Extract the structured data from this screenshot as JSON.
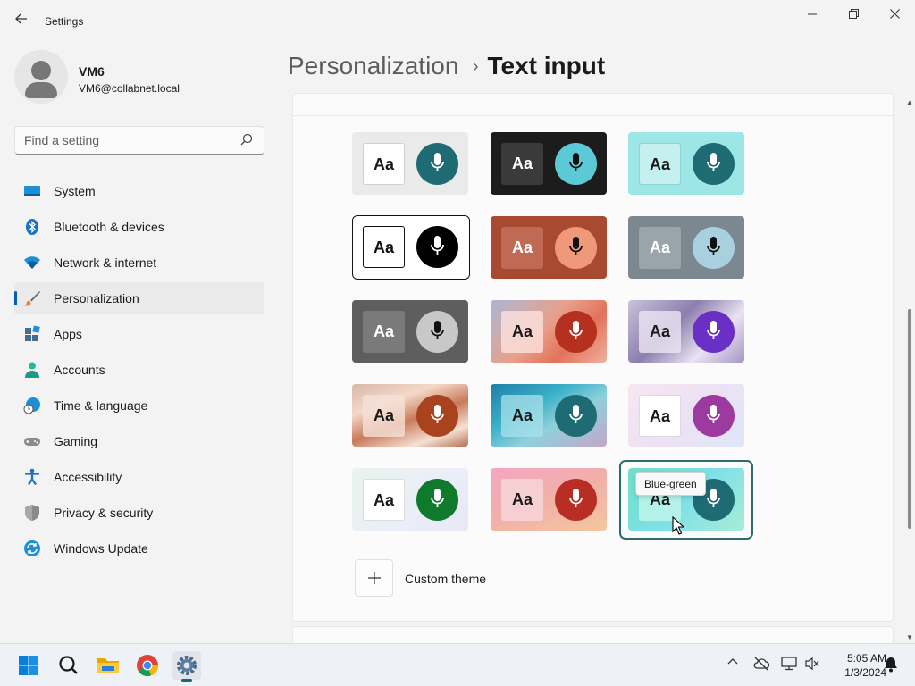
{
  "window": {
    "app_title": "Settings",
    "back_icon": "back-arrow-icon",
    "controls": [
      "minimize-icon",
      "restore-icon",
      "close-icon"
    ]
  },
  "profile": {
    "name": "VM6",
    "email": "VM6@collabnet.local"
  },
  "search": {
    "placeholder": "Find a setting"
  },
  "sidebar": {
    "items": [
      {
        "label": "System",
        "icon": "system-icon"
      },
      {
        "label": "Bluetooth & devices",
        "icon": "bluetooth-icon"
      },
      {
        "label": "Network & internet",
        "icon": "wifi-icon"
      },
      {
        "label": "Personalization",
        "icon": "brush-icon",
        "selected": true
      },
      {
        "label": "Apps",
        "icon": "apps-icon"
      },
      {
        "label": "Accounts",
        "icon": "accounts-icon"
      },
      {
        "label": "Time & language",
        "icon": "time-language-icon"
      },
      {
        "label": "Gaming",
        "icon": "gaming-icon"
      },
      {
        "label": "Accessibility",
        "icon": "accessibility-icon"
      },
      {
        "label": "Privacy & security",
        "icon": "shield-icon"
      },
      {
        "label": "Windows Update",
        "icon": "windows-update-icon"
      }
    ]
  },
  "header": {
    "parent": "Personalization",
    "separator": "›",
    "current": "Text input"
  },
  "themes": {
    "tooltip": "Blue-green",
    "selected_index": 14,
    "aa_label": "Aa",
    "custom_label": "Custom theme"
  },
  "taskbar": {
    "time": "5:05 AM",
    "date": "1/3/2024",
    "apps": [
      "start-icon",
      "search-icon",
      "file-explorer-icon",
      "chrome-icon",
      "settings-icon"
    ]
  },
  "colors": {
    "accent": "#005fb8",
    "selected_border": "#2d6a6a"
  }
}
